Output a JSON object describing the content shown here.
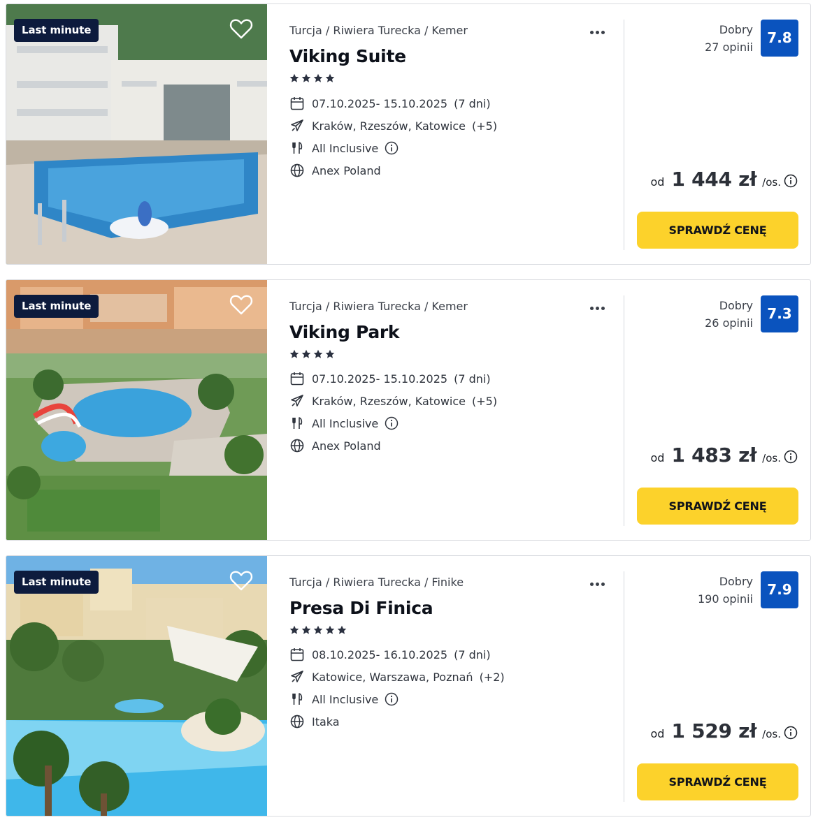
{
  "offers": [
    {
      "badge": "Last minute",
      "location": "Turcja / Riwiera Turecka / Kemer",
      "name": "Viking Suite",
      "stars": 4,
      "dates": "07.10.2025- 15.10.2025",
      "duration": "(7 dni)",
      "airports": "Kraków, Rzeszów, Katowice",
      "airports_more": "(+5)",
      "board": "All Inclusive",
      "operator": "Anex Poland",
      "rating_label": "Dobry",
      "reviews": "27 opinii",
      "score": "7.8",
      "price_prefix": "od",
      "price": "1 444 zł",
      "price_unit": "/os.",
      "cta": "SPRAWDŹ CENĘ"
    },
    {
      "badge": "Last minute",
      "location": "Turcja / Riwiera Turecka / Kemer",
      "name": "Viking Park",
      "stars": 4,
      "dates": "07.10.2025- 15.10.2025",
      "duration": "(7 dni)",
      "airports": "Kraków, Rzeszów, Katowice",
      "airports_more": "(+5)",
      "board": "All Inclusive",
      "operator": "Anex Poland",
      "rating_label": "Dobry",
      "reviews": "26 opinii",
      "score": "7.3",
      "price_prefix": "od",
      "price": "1 483 zł",
      "price_unit": "/os.",
      "cta": "SPRAWDŹ CENĘ"
    },
    {
      "badge": "Last minute",
      "location": "Turcja / Riwiera Turecka / Finike",
      "name": "Presa Di Finica",
      "stars": 5,
      "dates": "08.10.2025- 16.10.2025",
      "duration": "(7 dni)",
      "airports": "Katowice, Warszawa, Poznań",
      "airports_more": "(+2)",
      "board": "All Inclusive",
      "operator": "Itaka",
      "rating_label": "Dobry",
      "reviews": "190 opinii",
      "score": "7.9",
      "price_prefix": "od",
      "price": "1 529 zł",
      "price_unit": "/os.",
      "cta": "SPRAWDŹ CENĘ"
    }
  ],
  "icons": {
    "favorite": "heart-outline-icon",
    "menu": "more-dots-icon",
    "date": "calendar-icon",
    "flight": "plane-icon",
    "board": "cutlery-icon",
    "operator": "globe-icon",
    "info": "info-circle-icon",
    "star": "star-icon"
  },
  "colors": {
    "badge_bg": "#0d1b3d",
    "score_bg": "#0a53be",
    "cta_bg": "#fcd22b",
    "star": "#2b3140"
  }
}
